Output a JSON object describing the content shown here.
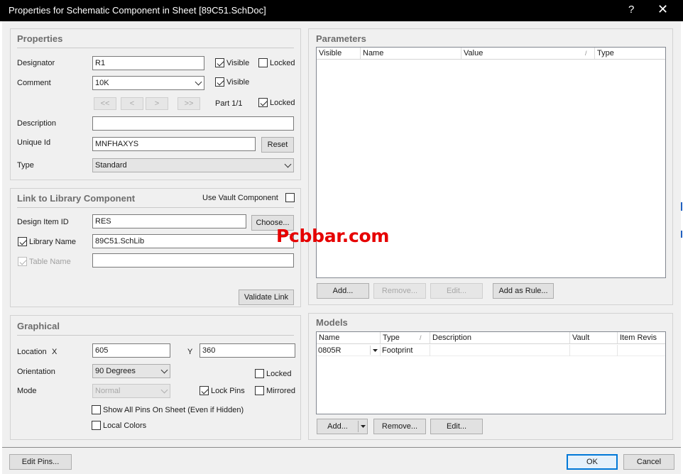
{
  "window": {
    "title": "Properties for Schematic Component in Sheet [89C51.SchDoc]",
    "help_glyph": "?",
    "close_glyph": "✕"
  },
  "properties": {
    "title": "Properties",
    "designator_label": "Designator",
    "designator_value": "R1",
    "visible_label": "Visible",
    "locked_label": "Locked",
    "comment_label": "Comment",
    "comment_value": "10K",
    "nav": [
      "<<",
      "<",
      ">",
      ">>"
    ],
    "part_label": "Part 1/1",
    "description_label": "Description",
    "description_value": "",
    "unique_id_label": "Unique Id",
    "unique_id_value": "MNFHAXYS",
    "reset_label": "Reset",
    "type_label": "Type",
    "type_value": "Standard",
    "designator_visible": true,
    "designator_locked": false,
    "comment_visible": true,
    "part_locked": true
  },
  "link": {
    "title": "Link to Library Component",
    "use_vault_label": "Use Vault Component",
    "use_vault": false,
    "design_item_label": "Design Item ID",
    "design_item_value": "RES",
    "choose_label": "Choose...",
    "library_name_label": "Library Name",
    "library_name_checked": true,
    "library_name_value": "89C51.SchLib",
    "table_name_label": "Table Name",
    "table_name_checked": true,
    "table_name_value": "",
    "validate_label": "Validate Link"
  },
  "graphical": {
    "title": "Graphical",
    "location_label": "Location",
    "x_label": "X",
    "x_value": "605",
    "y_label": "Y",
    "y_value": "360",
    "orientation_label": "Orientation",
    "orientation_value": "90 Degrees",
    "locked_label": "Locked",
    "locked": false,
    "mode_label": "Mode",
    "mode_value": "Normal",
    "lock_pins_label": "Lock Pins",
    "lock_pins": true,
    "mirrored_label": "Mirrored",
    "mirrored": false,
    "show_all_pins_label": "Show All Pins On Sheet (Even if Hidden)",
    "show_all_pins": false,
    "local_colors_label": "Local Colors",
    "local_colors": false
  },
  "parameters": {
    "title": "Parameters",
    "columns": [
      "Visible",
      "Name",
      "Value",
      "Type"
    ],
    "sort_glyph": "/",
    "rows": [],
    "buttons": {
      "add": "Add...",
      "remove": "Remove...",
      "edit": "Edit...",
      "add_as_rule": "Add as Rule..."
    }
  },
  "models": {
    "title": "Models",
    "columns": [
      "Name",
      "Type",
      "Description",
      "Vault",
      "Item Revis"
    ],
    "sort_glyph": "/",
    "rows": [
      {
        "name": "0805R",
        "type": "Footprint",
        "description": "",
        "vault": "",
        "item_revision": ""
      }
    ],
    "buttons": {
      "add": "Add...",
      "remove": "Remove...",
      "edit": "Edit..."
    }
  },
  "footer": {
    "edit_pins": "Edit Pins...",
    "ok": "OK",
    "cancel": "Cancel"
  },
  "watermark": "Pcbbar.com",
  "colors": {
    "titlebar": "#000000",
    "dialog": "#f0f0f0",
    "watermark": "#e60000",
    "accent": "#0078d7"
  }
}
